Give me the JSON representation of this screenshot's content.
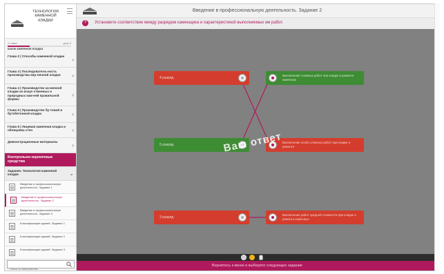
{
  "sidebar": {
    "title": "ТЕХНОЛОГИЯ КАМЕННОЙ КЛАДКИ",
    "progress_left": "1 глава",
    "progress_right": "урок 3",
    "progress_value": 0.35,
    "subtitle": "шахм каменная кладка",
    "chapters": [
      {
        "label": "Глава 2 | Способы каменной кладки"
      },
      {
        "label": "Глава 3 | Последователь-ность производства кир-пичной кладки"
      },
      {
        "label": "Глава 4 | Производство ка-менной кладки из искус-ственных и природных кам-ней правильной формы"
      },
      {
        "label": "Глава 5 | Производство бу-товой и бутобетонной кладки"
      },
      {
        "label": "Глава 6 | Лицевая каменная кладка и облицовка стен"
      },
      {
        "label": "Демонстрационные материалы"
      }
    ],
    "active_section": "Контрольно-оценочные средства",
    "sub_section": "Задание. Технология каменной кладки",
    "tasks": [
      {
        "label": "Введение в профессиональную деятельность. Задание 1"
      },
      {
        "label": "Введение в профессиональную деятельность. Задание 2"
      },
      {
        "label": "Введение в профессиональную деятельность. Задание 3"
      },
      {
        "label": "Классификация зданий. Задание 1"
      },
      {
        "label": "Классификация зданий. Задание 2"
      },
      {
        "label": "Классификация зданий. Задание 3"
      }
    ],
    "search_placeholder": "Поиск по материалам"
  },
  "main": {
    "title": "Введение в профессиональную деятельность. Задание 2",
    "instruction": "Установите соответствие между разрядом каменщика и характеристикой выполняемых им работ.",
    "left_items": [
      {
        "label": "4 разряд",
        "color": "red"
      },
      {
        "label": "5 разряд",
        "color": "green"
      },
      {
        "label": "3 разряд",
        "color": "red"
      }
    ],
    "right_items": [
      {
        "label": "Выполнение сложных работ при кладке и ремонте каменных",
        "color": "green"
      },
      {
        "label": "Выполнение особо сложных работ при кладке и ремонте",
        "color": "red"
      },
      {
        "label": "Выполнение работ средней сложности при кладке и ремонте каменных",
        "color": "red"
      }
    ],
    "stamp": "Ваш ответ",
    "footer": "Вернитесь к меню и выберите следующее задание"
  },
  "colors": {
    "accent": "#b01a5d",
    "red_card": "#d43d2d",
    "green_card": "#3e8c34",
    "stage": "#818181"
  }
}
